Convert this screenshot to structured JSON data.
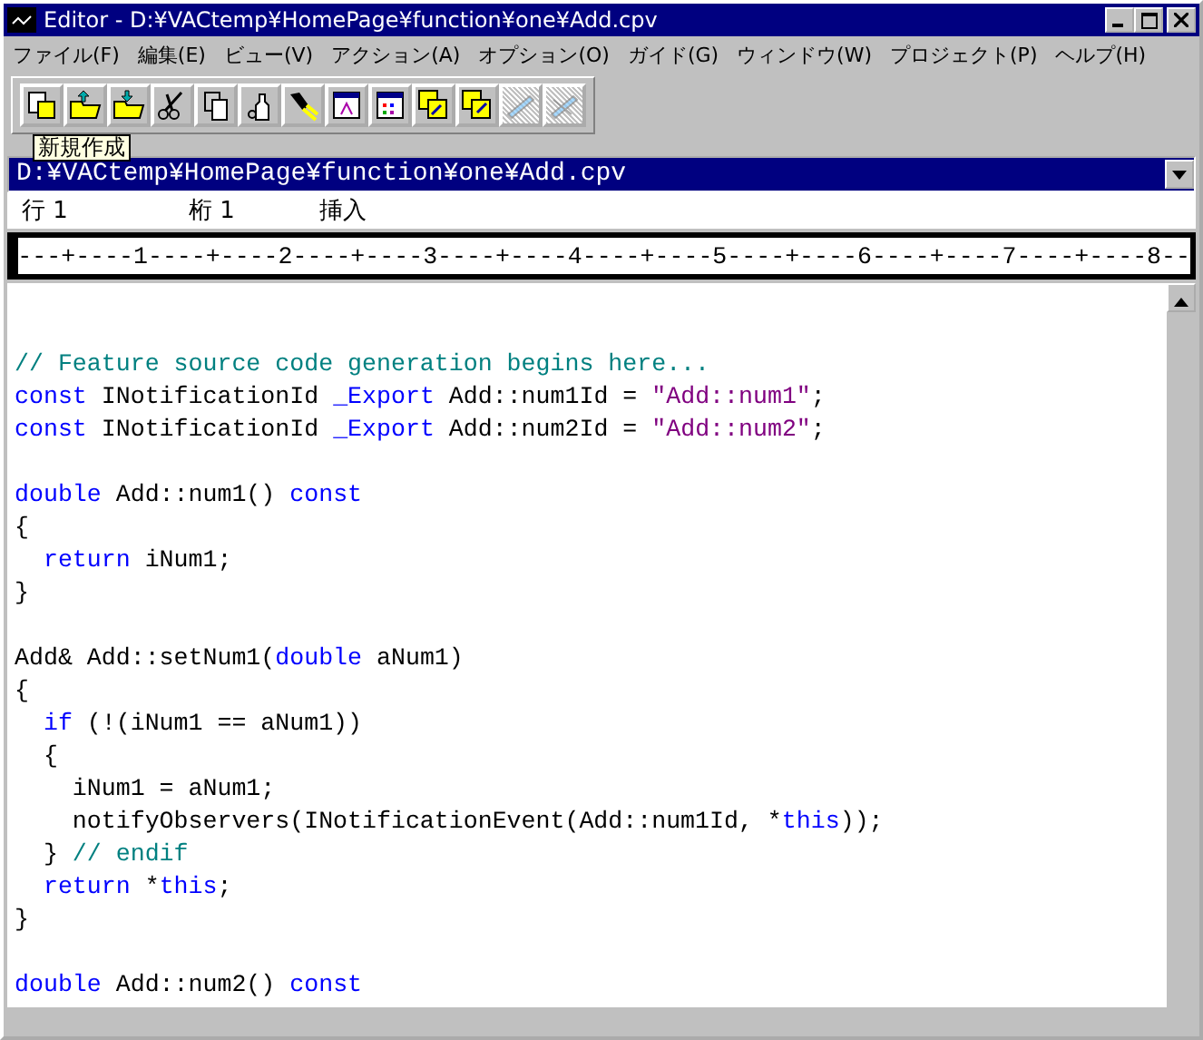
{
  "window": {
    "title": "Editor - D:¥VACtemp¥HomePage¥function¥one¥Add.cpv"
  },
  "menu": [
    "ファイル(F)",
    "編集(E)",
    "ビュー(V)",
    "アクション(A)",
    "オプション(O)",
    "ガイド(G)",
    "ウィンドウ(W)",
    "プロジェクト(P)",
    "ヘルプ(H)"
  ],
  "toolbar": [
    {
      "disabled": false
    },
    {
      "disabled": false
    },
    {
      "disabled": false
    },
    {
      "disabled": false
    },
    {
      "disabled": false
    },
    {
      "disabled": false
    },
    {
      "disabled": false
    },
    {
      "disabled": false
    },
    {
      "disabled": false
    },
    {
      "disabled": false
    },
    {
      "disabled": false
    },
    {
      "disabled": true
    },
    {
      "disabled": true
    }
  ],
  "tooltip": "新規作成",
  "file_selector": {
    "value": "D:¥VACtemp¥HomePage¥function¥one¥Add.cpv"
  },
  "status": {
    "line": "行 1",
    "column": "桁 1",
    "mode": "挿入"
  },
  "ruler": "---+----1----+----2----+----3----+----4----+----5----+----6----+----7----+----8--",
  "code": [
    {
      "kind": "blank"
    },
    {
      "kind": "blank"
    },
    {
      "kind": "code",
      "tokens": [
        {
          "kind": "comment",
          "text": "// Feature source code generation begins here..."
        }
      ]
    },
    {
      "kind": "code",
      "tokens": [
        {
          "kind": "keyword",
          "text": "const"
        },
        {
          "kind": "plain",
          "text": " INotificationId "
        },
        {
          "kind": "keyword",
          "text": "_Export"
        },
        {
          "kind": "plain",
          "text": " Add::num1Id = "
        },
        {
          "kind": "string",
          "text": "\"Add::num1\""
        },
        {
          "kind": "plain",
          "text": ";"
        }
      ]
    },
    {
      "kind": "code",
      "tokens": [
        {
          "kind": "keyword",
          "text": "const"
        },
        {
          "kind": "plain",
          "text": " INotificationId "
        },
        {
          "kind": "keyword",
          "text": "_Export"
        },
        {
          "kind": "plain",
          "text": " Add::num2Id = "
        },
        {
          "kind": "string",
          "text": "\"Add::num2\""
        },
        {
          "kind": "plain",
          "text": ";"
        }
      ]
    },
    {
      "kind": "blank"
    },
    {
      "kind": "code",
      "tokens": [
        {
          "kind": "keyword",
          "text": "double"
        },
        {
          "kind": "plain",
          "text": " Add::num1() "
        },
        {
          "kind": "keyword",
          "text": "const"
        }
      ]
    },
    {
      "kind": "code",
      "tokens": [
        {
          "kind": "plain",
          "text": "{"
        }
      ]
    },
    {
      "kind": "code",
      "tokens": [
        {
          "kind": "keyword",
          "text": "  return"
        },
        {
          "kind": "plain",
          "text": " iNum1;"
        }
      ]
    },
    {
      "kind": "code",
      "tokens": [
        {
          "kind": "plain",
          "text": "}"
        }
      ]
    },
    {
      "kind": "blank"
    },
    {
      "kind": "code",
      "tokens": [
        {
          "kind": "plain",
          "text": "Add& Add::setNum1("
        },
        {
          "kind": "keyword",
          "text": "double"
        },
        {
          "kind": "plain",
          "text": " aNum1)"
        }
      ]
    },
    {
      "kind": "code",
      "tokens": [
        {
          "kind": "plain",
          "text": "{"
        }
      ]
    },
    {
      "kind": "code",
      "tokens": [
        {
          "kind": "keyword",
          "text": "  if"
        },
        {
          "kind": "plain",
          "text": " (!(iNum1 == aNum1))"
        }
      ]
    },
    {
      "kind": "code",
      "tokens": [
        {
          "kind": "plain",
          "text": "  {"
        }
      ]
    },
    {
      "kind": "code",
      "tokens": [
        {
          "kind": "plain",
          "text": "    iNum1 = aNum1;"
        }
      ]
    },
    {
      "kind": "code",
      "tokens": [
        {
          "kind": "plain",
          "text": "    notifyObservers(INotificationEvent(Add::num1Id, *"
        },
        {
          "kind": "keyword",
          "text": "this"
        },
        {
          "kind": "plain",
          "text": "));"
        }
      ]
    },
    {
      "kind": "code",
      "tokens": [
        {
          "kind": "plain",
          "text": "  } "
        },
        {
          "kind": "comment",
          "text": "// endif"
        }
      ]
    },
    {
      "kind": "code",
      "tokens": [
        {
          "kind": "keyword",
          "text": "  return"
        },
        {
          "kind": "plain",
          "text": " *"
        },
        {
          "kind": "keyword",
          "text": "this"
        },
        {
          "kind": "plain",
          "text": ";"
        }
      ]
    },
    {
      "kind": "code",
      "tokens": [
        {
          "kind": "plain",
          "text": "}"
        }
      ]
    },
    {
      "kind": "blank"
    },
    {
      "kind": "code",
      "tokens": [
        {
          "kind": "keyword",
          "text": "double"
        },
        {
          "kind": "plain",
          "text": " Add::num2() "
        },
        {
          "kind": "keyword",
          "text": "const"
        }
      ]
    }
  ]
}
